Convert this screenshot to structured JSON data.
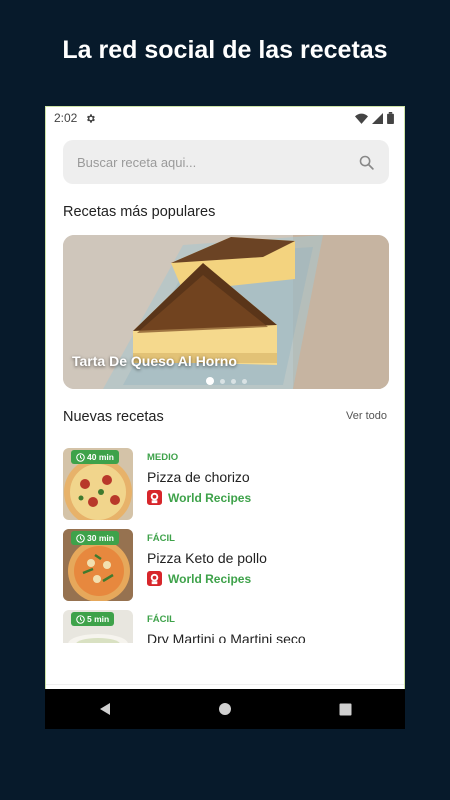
{
  "promo": {
    "headline": "La red social de las recetas"
  },
  "status_bar": {
    "time": "2:02",
    "settings_icon": "gear-icon",
    "wifi_icon": "wifi-icon",
    "signal_icon": "signal-icon",
    "battery_icon": "battery-icon"
  },
  "search": {
    "placeholder": "Buscar receta aqui...",
    "icon": "search-icon"
  },
  "popular": {
    "title": "Recetas más populares",
    "featured": {
      "caption": "Tarta De Queso Al Horno"
    },
    "dots": 4,
    "active_dot": 0
  },
  "new_recipes": {
    "title": "Nuevas recetas",
    "see_all": "Ver todo",
    "items": [
      {
        "time": "40 min",
        "level": "MEDIO",
        "name": "Pizza de chorizo",
        "author": "World Recipes"
      },
      {
        "time": "30 min",
        "level": "FÁCIL",
        "name": "Pizza Keto de pollo",
        "author": "World Recipes"
      },
      {
        "time": "5 min",
        "level": "FÁCIL",
        "name": "Dry Martini o Martini seco",
        "author": ""
      }
    ]
  },
  "bottom_nav": {
    "items": [
      "home-icon",
      "categories-icon",
      "add-icon",
      "explore-icon",
      "profile-icon"
    ],
    "active": "home-icon"
  },
  "system_nav": {
    "items": [
      "back-icon",
      "home-circle-icon",
      "recents-icon"
    ]
  },
  "colors": {
    "accent": "#3ea24a",
    "background": "#071a2b"
  }
}
